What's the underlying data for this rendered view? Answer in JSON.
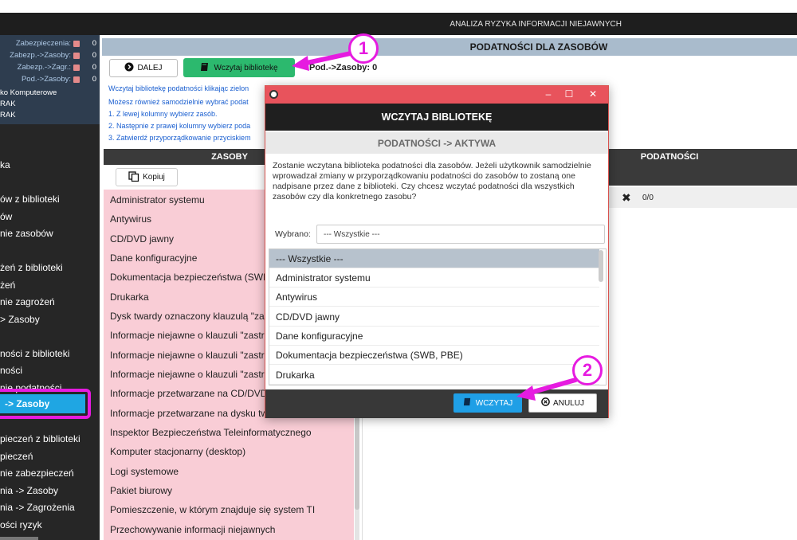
{
  "app": {
    "title": "ANALIZA RYZYKA INFORMACJI NIEJAWNYCH"
  },
  "sidebar": {
    "status": [
      {
        "label": "Zabezpieczenia:",
        "value": "0"
      },
      {
        "label": "Zabezp.->Zasoby:",
        "value": "0"
      },
      {
        "label": "Zabezp.->Zagr.:",
        "value": "0"
      },
      {
        "label": "Pod.->Zasoby:",
        "value": "0"
      }
    ],
    "info": [
      "ko Komputerowe",
      "RAK",
      "RAK"
    ],
    "nav": [
      "ka",
      "ów z biblioteki",
      "ów",
      "nie zasobów",
      "żeń z biblioteki",
      "żeń",
      "nie zagrożeń",
      "> Zasoby",
      "ności z biblioteki",
      "ności",
      "nie podatności",
      "pieczeń z biblioteki",
      "pieczeń",
      "nie zabezpieczeń",
      "nia -> Zasoby",
      "nia -> Zagrożenia",
      "ości ryzyk"
    ],
    "active": "-> Zasoby"
  },
  "main": {
    "header": "PODATNOŚCI DLA ZASOBÓW",
    "dalej_label": "DALEJ",
    "wczytaj_bib_label": "Wczytaj bibliotekę",
    "counter": "Pod.->Zasoby: 0",
    "instructions": [
      "Wczytaj bibliotekę podatności klikając zielon",
      "Możesz również samodzielnie wybrać podat",
      "1. Z lewej kolumny wybierz zasób.",
      "2. Następnie z prawej kolumny wybierz poda",
      "3. Zatwierdź przyporządkowanie przyciskiem"
    ]
  },
  "zasoby": {
    "header": "ZASOBY",
    "kopiuj_label": "Kopiuj",
    "items": [
      "Administrator systemu",
      "Antywirus",
      "CD/DVD jawny",
      "Dane konfiguracyjne",
      "Dokumentacja bezpieczeństwa (SWB",
      "Drukarka",
      "Dysk twardy oznaczony klauzulą \"zas",
      "Informacje niejawne o klauzuli \"zastr.",
      "Informacje niejawne o klauzuli \"zastr.",
      "Informacje niejawne o klauzuli \"zastr.",
      "Informacje przetwarzane na CD/DVD",
      "Informacje przetwarzane na dysku tw",
      "Inspektor Bezpieczeństwa Teleinformatycznego",
      "Komputer stacjonarny (desktop)",
      "Logi systemowe",
      "Pakiet biurowy",
      "Pomieszczenie, w którym znajduje się system TI",
      "Przechowywanie informacji niejawnych"
    ]
  },
  "podatnosci": {
    "header": "PODATNOŚCI",
    "row_count": "0/0"
  },
  "dialog": {
    "title": "WCZYTAJ BIBLIOTEKĘ",
    "subtitle": "PODATNOŚCI -> AKTYWA",
    "message": "Zostanie wczytana biblioteka podatności dla zasobów. Jeżeli użytkownik samodzielnie wprowadzał zmiany w przyporządkowaniu podatności do zasobów to zostaną one nadpisane przez dane z biblioteki. Czy chcesz wczytać podatności dla wszystkich zasobów czy dla konkretnego zasobu?",
    "wybrano_label": "Wybrano:",
    "wybrano_value": "--- Wszystkie ---",
    "options": [
      "--- Wszystkie ---",
      "Administrator systemu",
      "Antywirus",
      "CD/DVD jawny",
      "Dane konfiguracyjne",
      "Dokumentacja bezpieczeństwa (SWB, PBE)",
      "Drukarka"
    ],
    "wczytaj_label": "WCZYTAJ",
    "anuluj_label": "ANULUJ"
  },
  "annotations": {
    "one": "1",
    "two": "2",
    "color": "#e61be0"
  }
}
